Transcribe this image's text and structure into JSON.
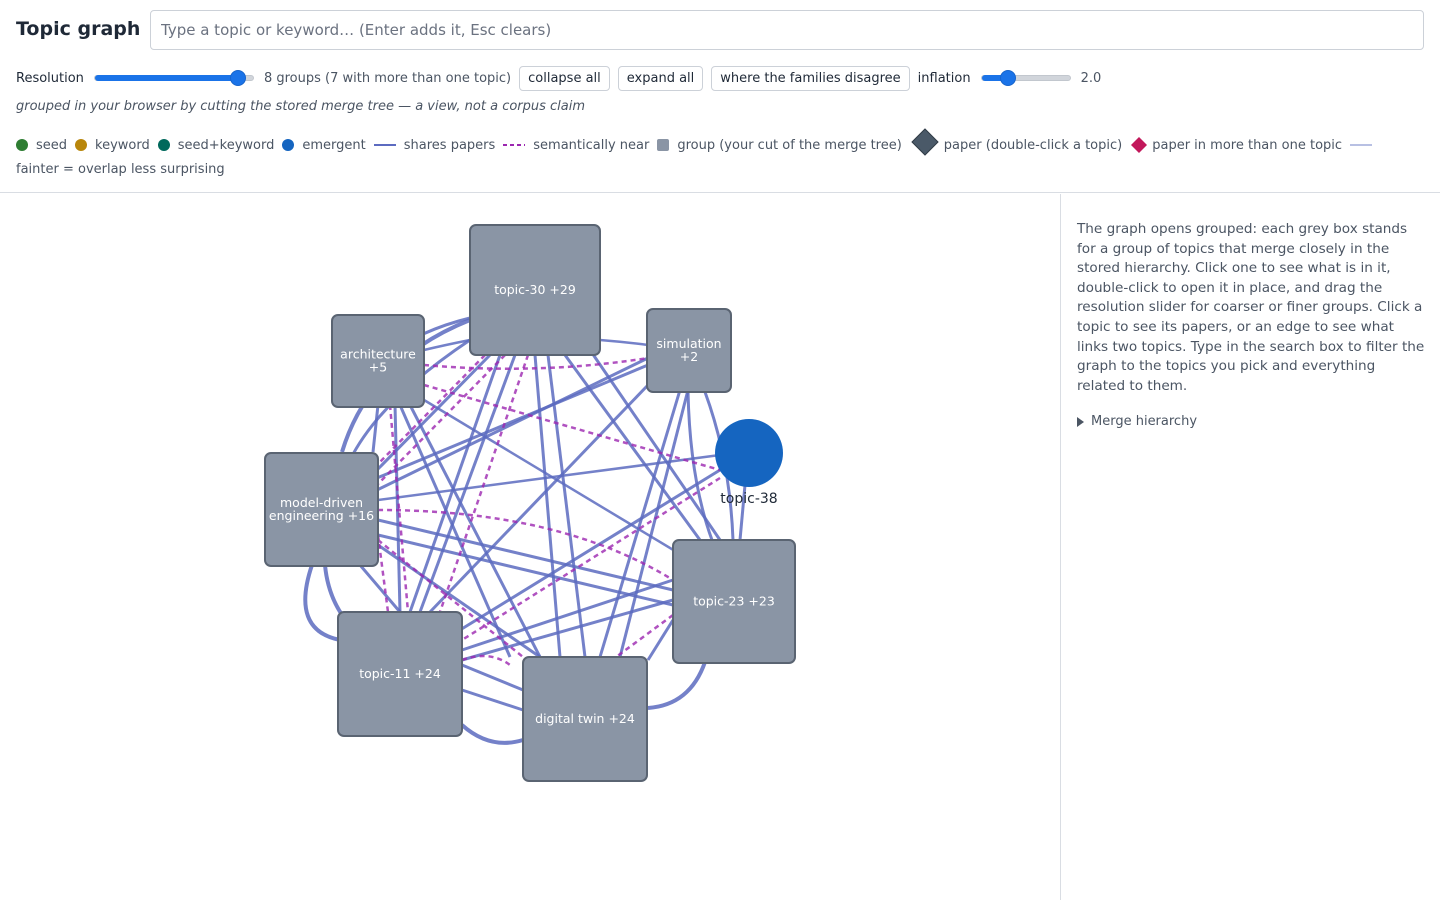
{
  "header": {
    "title": "Topic graph",
    "search_placeholder": "Type a topic or keyword… (Enter adds it, Esc clears)"
  },
  "controls": {
    "resolution_label": "Resolution",
    "resolution_value": 0.9,
    "groups_summary": "8 groups (7 with more than one topic)",
    "collapse_all": "collapse all",
    "expand_all": "expand all",
    "disagree": "where the families disagree",
    "inflation_label": "inflation",
    "inflation_value": "2.0",
    "inflation_fraction": 0.3
  },
  "note": "grouped in your browser by cutting the stored merge tree — a view, not a corpus claim",
  "legend": {
    "seed": "seed",
    "keyword": "keyword",
    "seed_keyword": "seed+keyword",
    "emergent": "emergent",
    "shares_papers": "shares papers",
    "semantically_near": "semantically near",
    "group": "group (your cut of the merge tree)",
    "paper": "paper (double-click a topic)",
    "paper_multi": "paper in more than one topic",
    "fainter": "fainter = overlap less surprising"
  },
  "colors": {
    "seed": "#2e7d32",
    "keyword": "#b8860b",
    "seed_keyword": "#00695c",
    "emergent": "#1565c0",
    "shares_papers": "#5c6bc0",
    "semantically_near": "#9c27b0",
    "group": "#8a95a5",
    "paper": "#4a5968",
    "paper_multi": "#c2185b",
    "accent": "#1a73e8"
  },
  "graph": {
    "groups": [
      {
        "id": "g30",
        "label": [
          "topic-30 +29"
        ]
      },
      {
        "id": "garch",
        "label": [
          "architecture",
          "+5"
        ]
      },
      {
        "id": "gsim",
        "label": [
          "simulation",
          "+2"
        ]
      },
      {
        "id": "gmde",
        "label": [
          "model-driven",
          "engineering +16"
        ]
      },
      {
        "id": "g23",
        "label": [
          "topic-23 +23"
        ]
      },
      {
        "id": "g11",
        "label": [
          "topic-11 +24"
        ]
      },
      {
        "id": "gdt",
        "label": [
          "digital twin +24"
        ]
      }
    ],
    "topics": [
      {
        "id": "t38",
        "label": "topic-38",
        "kind": "emergent"
      }
    ]
  },
  "sidebar": {
    "text": "The graph opens grouped: each grey box stands for a group of topics that merge closely in the stored hierarchy. Click one to see what is in it, double-click to open it in place, and drag the resolution slider for coarser or finer groups. Click a topic to see its papers, or an edge to see what links two topics. Type in the search box to filter the graph to the topics you pick and everything related to them.",
    "merge_hierarchy": "Merge hierarchy"
  }
}
